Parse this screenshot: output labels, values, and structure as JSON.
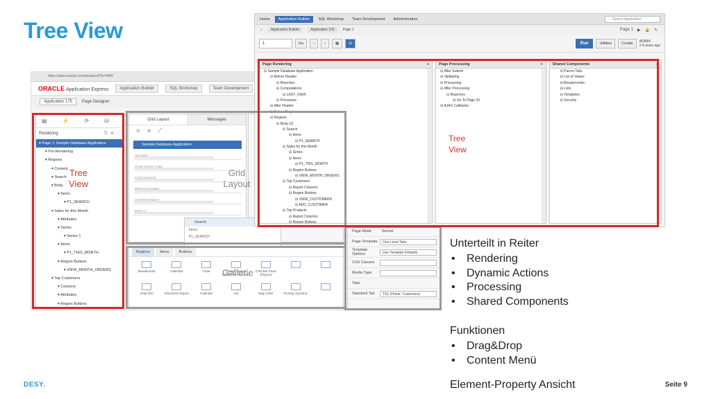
{
  "slide": {
    "title": "Tree View",
    "footer_logo": "DESY.",
    "footer_page": "Seite 9"
  },
  "notes": {
    "heading1": "Unterteilt in Reiter",
    "items1": [
      "Rendering",
      "Dynamic Actions",
      "Processing",
      "Shared Components"
    ],
    "heading2": "Funktionen",
    "items2": [
      "Drag&Drop",
      "Content Menü"
    ],
    "bottom": "Element-Property Ansicht"
  },
  "overlays": {
    "tree_left": "Tree View",
    "grid": "Grid Layout",
    "gallery": "Gallerie",
    "tree_right": "Tree View"
  },
  "page_designer": {
    "url": "https://apex.oracle.com/pls/apex/f?p=4000",
    "brand": "ORACLE",
    "brand_sub": "Application Express",
    "tabs": [
      "Application Builder",
      "SQL Workshop",
      "Team Development"
    ],
    "app_label": "Application 175",
    "designer_label": "Page Designer",
    "left_bar_label": "Rendering",
    "tree_rows": [
      {
        "text": "Page 1: Sample Database Application",
        "level": 0,
        "selected": true
      },
      {
        "text": "Pre-Rendering",
        "level": 1
      },
      {
        "text": "Regions",
        "level": 1
      },
      {
        "text": "Content",
        "level": 2
      },
      {
        "text": "Search",
        "level": 2
      },
      {
        "text": "Body",
        "level": 2
      },
      {
        "text": "Items",
        "level": 3
      },
      {
        "text": "P1_SEARCH",
        "level": 4
      },
      {
        "text": "Sales for this Month",
        "level": 2
      },
      {
        "text": "Attributes",
        "level": 3
      },
      {
        "text": "Series",
        "level": 3
      },
      {
        "text": "Series 1",
        "level": 4
      },
      {
        "text": "Items",
        "level": 3
      },
      {
        "text": "P1_THIS_MONTH",
        "level": 4
      },
      {
        "text": "Region Buttons",
        "level": 3
      },
      {
        "text": "VIEW_MONTH_ORDERS",
        "level": 4
      },
      {
        "text": "Top Customers",
        "level": 2
      },
      {
        "text": "Columns",
        "level": 3
      },
      {
        "text": "Attributes",
        "level": 3
      },
      {
        "text": "Region Buttons",
        "level": 3
      },
      {
        "text": "VIEW_CUSTOMERS",
        "level": 4
      },
      {
        "text": "ADD_CUSTOMER",
        "level": 4
      }
    ],
    "grid_tabs": [
      "Grid Layout",
      "Messages"
    ],
    "grid_title": "Sample Database Application",
    "grid_slots": [
      "HEADER",
      "PAGE LEVEL TABS",
      "ICON NAVBAR",
      "BREADCRUMBS",
      "CONTENT BODY",
      "BODY 3"
    ],
    "search_card_title": "Search",
    "search_card_rows": [
      "Items",
      "P1_SEARCH"
    ],
    "gallery_tabs": [
      "Regions",
      "Items",
      "Buttons"
    ],
    "gallery_items": [
      "Breadcrumb",
      "Calendar",
      "Chart",
      "Classic Report (based on Function)",
      "CSS Bar Chart (Plug-in)",
      "",
      "",
      "Help Text",
      "Interactive Report",
      "Calendar",
      "List",
      "Map Chart",
      "PL/SQL Dynamic",
      ""
    ],
    "props": [
      {
        "k": "Page Mode",
        "v": "Normal",
        "box": false
      },
      {
        "k": "Page Template",
        "v": "One Level Tabs",
        "box": true
      },
      {
        "k": "Template Options",
        "v": "Use Template Defaults",
        "box": true
      },
      {
        "k": "CSS Classes",
        "v": "",
        "box": true
      },
      {
        "k": "Media Type",
        "v": "",
        "box": true
      },
      {
        "k": "Tabs",
        "v": "",
        "box": false
      },
      {
        "k": "Standard Tab",
        "v": "TS1 (Home, Customers)",
        "box": true
      }
    ]
  },
  "tree_view": {
    "nav_tabs": [
      "Home",
      "Application Builder",
      "SQL Workshop",
      "Team Development",
      "Administration"
    ],
    "search_placeholder": "Search Application",
    "breadcrumbs": [
      "Application Builder",
      "Application 103",
      "Page 1"
    ],
    "page_label": "Page 1",
    "page_input": "1",
    "go": "Go",
    "run": "Run",
    "utilities": "Utilities",
    "create": "Create",
    "admin_line1": "ADMIN",
    "admin_line2": "2.4 years ago",
    "columns": [
      {
        "title": "Page Rendering",
        "rows": [
          {
            "text": "Sample Database Application",
            "level": 0
          },
          {
            "text": "Before Header",
            "level": 1
          },
          {
            "text": "Branches",
            "level": 2
          },
          {
            "text": "Computations",
            "level": 2
          },
          {
            "text": "LAST_VIEW",
            "level": 3
          },
          {
            "text": "Processes",
            "level": 2
          },
          {
            "text": "After Header",
            "level": 1
          },
          {
            "text": "Before Regions",
            "level": 1
          },
          {
            "text": "Regions",
            "level": 1
          },
          {
            "text": "Body (3)",
            "level": 2
          },
          {
            "text": "Search",
            "level": 3
          },
          {
            "text": "Items",
            "level": 4
          },
          {
            "text": "P1_SEARCH",
            "level": 5
          },
          {
            "text": "Sales for this Month",
            "level": 3
          },
          {
            "text": "Series",
            "level": 4
          },
          {
            "text": "Items",
            "level": 4
          },
          {
            "text": "P1_THIS_MONTH",
            "level": 5
          },
          {
            "text": "Region Buttons",
            "level": 4
          },
          {
            "text": "VIEW_MONTH_ORDERS",
            "level": 5
          },
          {
            "text": "Top Customers",
            "level": 3
          },
          {
            "text": "Report Columns",
            "level": 4
          },
          {
            "text": "Region Buttons",
            "level": 4
          },
          {
            "text": "VIEW_CUSTOMERS",
            "level": 5
          },
          {
            "text": "ADD_CUSTOMER",
            "level": 5
          },
          {
            "text": "Top Products",
            "level": 3
          },
          {
            "text": "Report Columns",
            "level": 4
          },
          {
            "text": "Region Buttons",
            "level": 4
          }
        ]
      },
      {
        "title": "Page Processing",
        "rows": [
          {
            "text": "After Submit",
            "level": 0
          },
          {
            "text": "Validating",
            "level": 0
          },
          {
            "text": "Processing",
            "level": 0
          },
          {
            "text": "After Processing",
            "level": 0
          },
          {
            "text": "Branches",
            "level": 1
          },
          {
            "text": "Go To Page 30",
            "level": 2
          },
          {
            "text": "AJAX Callbacks",
            "level": 0
          }
        ]
      },
      {
        "title": "Shared Components",
        "rows": [
          {
            "text": "Parent Tabs",
            "level": 1
          },
          {
            "text": "List of Values",
            "level": 1
          },
          {
            "text": "Breadcrumbs",
            "level": 1
          },
          {
            "text": "Lists",
            "level": 1
          },
          {
            "text": "Templates",
            "level": 1
          },
          {
            "text": "Security",
            "level": 1
          }
        ]
      }
    ]
  }
}
